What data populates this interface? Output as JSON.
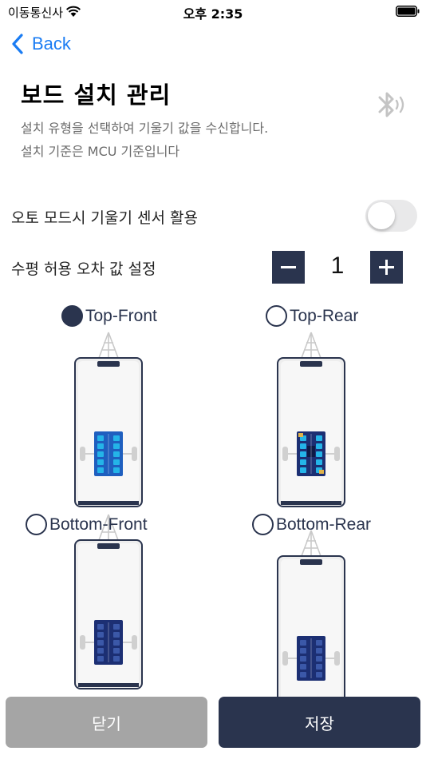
{
  "status_bar": {
    "carrier": "이동통신사",
    "time": "오후 2:35"
  },
  "nav": {
    "back_label": "Back"
  },
  "header": {
    "title": "보드 설치 관리",
    "description_line1": "설치 유형을 선택하여 기울기 값을 수신합니다.",
    "description_line2": "설치 기준은 MCU 기준입니다"
  },
  "settings": {
    "auto_mode_label": "오토 모드시 기울기 센서 활용",
    "auto_mode_enabled": false,
    "tolerance_label": "수평 허용 오차 값 설정",
    "tolerance_value": "1"
  },
  "mount_options": [
    {
      "label": "Top-Front",
      "selected": true,
      "view": "top",
      "board": "front"
    },
    {
      "label": "Top-Rear",
      "selected": false,
      "view": "top",
      "board": "rear"
    },
    {
      "label": "Bottom-Front",
      "selected": false,
      "view": "bottom",
      "board": "front"
    },
    {
      "label": "Bottom-Rear",
      "selected": false,
      "view": "bottom",
      "board": "rear"
    }
  ],
  "buttons": {
    "close_label": "닫기",
    "save_label": "저장"
  },
  "colors": {
    "accent": "#2a344e",
    "link": "#1a7cf3",
    "disabled": "#a5a5a5",
    "board_blue": "#1f5fbf",
    "board_dark": "#1c2f73",
    "chip_cyan": "#24b4e8"
  },
  "icons": {
    "back": "chevron-left-icon",
    "bluetooth": "bluetooth-icon",
    "minus": "minus-icon",
    "plus": "plus-icon",
    "wifi": "wifi-icon",
    "battery": "battery-icon"
  }
}
